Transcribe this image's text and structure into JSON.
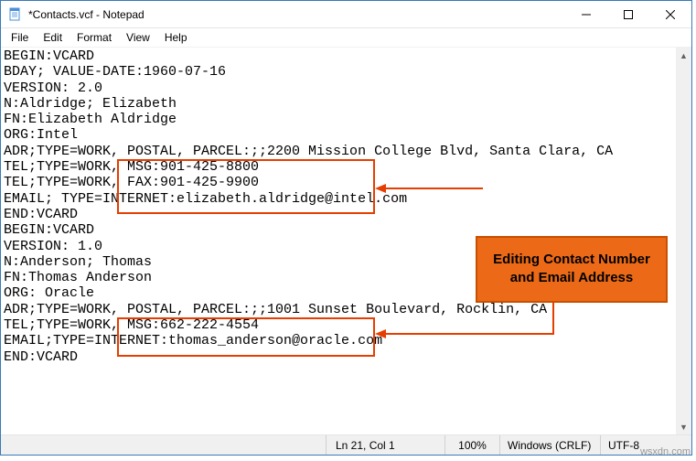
{
  "window": {
    "title": "*Contacts.vcf - Notepad"
  },
  "menu": {
    "file": "File",
    "edit": "Edit",
    "format": "Format",
    "view": "View",
    "help": "Help"
  },
  "content": {
    "lines": [
      "BEGIN:VCARD",
      "BDAY; VALUE-DATE:1960-07-16",
      "VERSION: 2.0",
      "N:Aldridge; Elizabeth",
      "FN:Elizabeth Aldridge",
      "ORG:Intel",
      "ADR;TYPE=WORK, POSTAL, PARCEL:;;2200 Mission College Blvd, Santa Clara, CA",
      "TEL;TYPE=WORK, MSG:901-425-8800",
      "TEL;TYPE=WORK, FAX:901-425-9900",
      "EMAIL; TYPE=INTERNET:elizabeth.aldridge@intel.com",
      "END:VCARD",
      "BEGIN:VCARD",
      "VERSION: 1.0",
      "N:Anderson; Thomas",
      "FN:Thomas Anderson",
      "ORG: Oracle",
      "ADR;TYPE=WORK, POSTAL, PARCEL:;;1001 Sunset Boulevard, Rocklin, CA",
      "TEL;TYPE=WORK, MSG:662-222-4554",
      "EMAIL;TYPE=INTERNET:thomas_anderson@oracle.com",
      "END:VCARD"
    ]
  },
  "status": {
    "position": "Ln 21, Col 1",
    "zoom": "100%",
    "eol": "Windows (CRLF)",
    "encoding": "UTF-8"
  },
  "annotation": {
    "callout_line1": "Editing Contact Number",
    "callout_line2": "and Email Address"
  },
  "watermark": "wsxdn.com"
}
